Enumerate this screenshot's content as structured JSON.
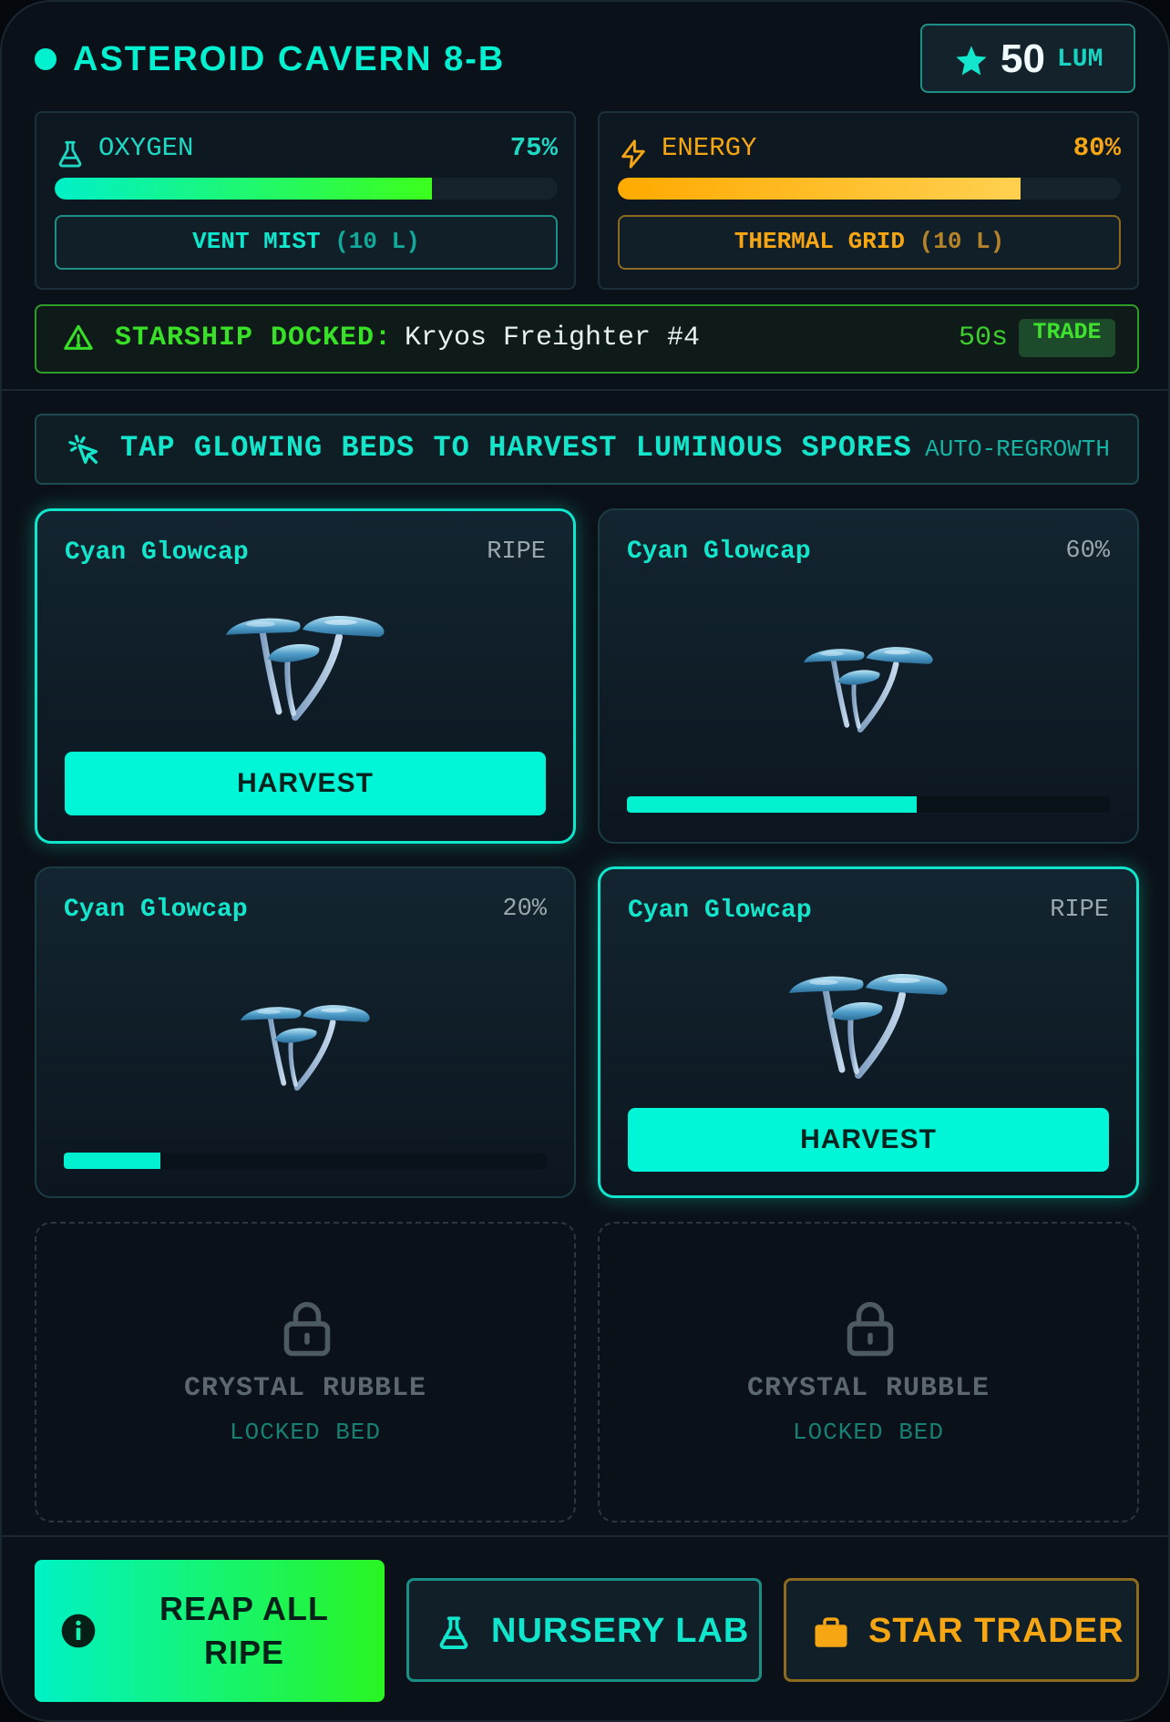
{
  "header": {
    "title": "ASTEROID CAVERN 8-B",
    "currency_amount": "50",
    "currency_unit": "LUM"
  },
  "resources": {
    "oxygen": {
      "label": "OXYGEN",
      "percent_text": "75%",
      "level": 0.75,
      "button_label": "VENT MIST",
      "button_cost": "(10 L)",
      "color": "#1fd8c4"
    },
    "energy": {
      "label": "ENERGY",
      "percent_text": "80%",
      "level": 0.8,
      "button_label": "THERMAL GRID",
      "button_cost": "(10 L)",
      "color": "#f6a612"
    }
  },
  "ship": {
    "label": "STARSHIP DOCKED:",
    "name": "Kryos Freighter #4",
    "timer": "50s",
    "trade_label": "TRADE"
  },
  "tip": {
    "text": "TAP GLOWING BEDS TO HARVEST LUMINOUS SPORES",
    "mode": "AUTO-REGROWTH"
  },
  "beds": [
    {
      "name": "Cyan Glowcap",
      "state": "RIPE",
      "ripe": true,
      "growth": 1.0,
      "action": "HARVEST"
    },
    {
      "name": "Cyan Glowcap",
      "state": "60%",
      "ripe": false,
      "growth": 0.6
    },
    {
      "name": "Cyan Glowcap",
      "state": "20%",
      "ripe": false,
      "growth": 0.2
    },
    {
      "name": "Cyan Glowcap",
      "state": "RIPE",
      "ripe": true,
      "growth": 1.0,
      "action": "HARVEST"
    }
  ],
  "locked_beds": [
    {
      "name": "CRYSTAL RUBBLE",
      "status": "LOCKED BED"
    },
    {
      "name": "CRYSTAL RUBBLE",
      "status": "LOCKED BED"
    }
  ],
  "footer": {
    "reap_line1": "REAP ALL",
    "reap_line2": "RIPE",
    "nursery_label": "NURSERY LAB",
    "trader_label": "STAR TRADER"
  },
  "colors": {
    "accent": "#00f0d0",
    "warning_green": "#38e028",
    "amber": "#f6a612"
  }
}
